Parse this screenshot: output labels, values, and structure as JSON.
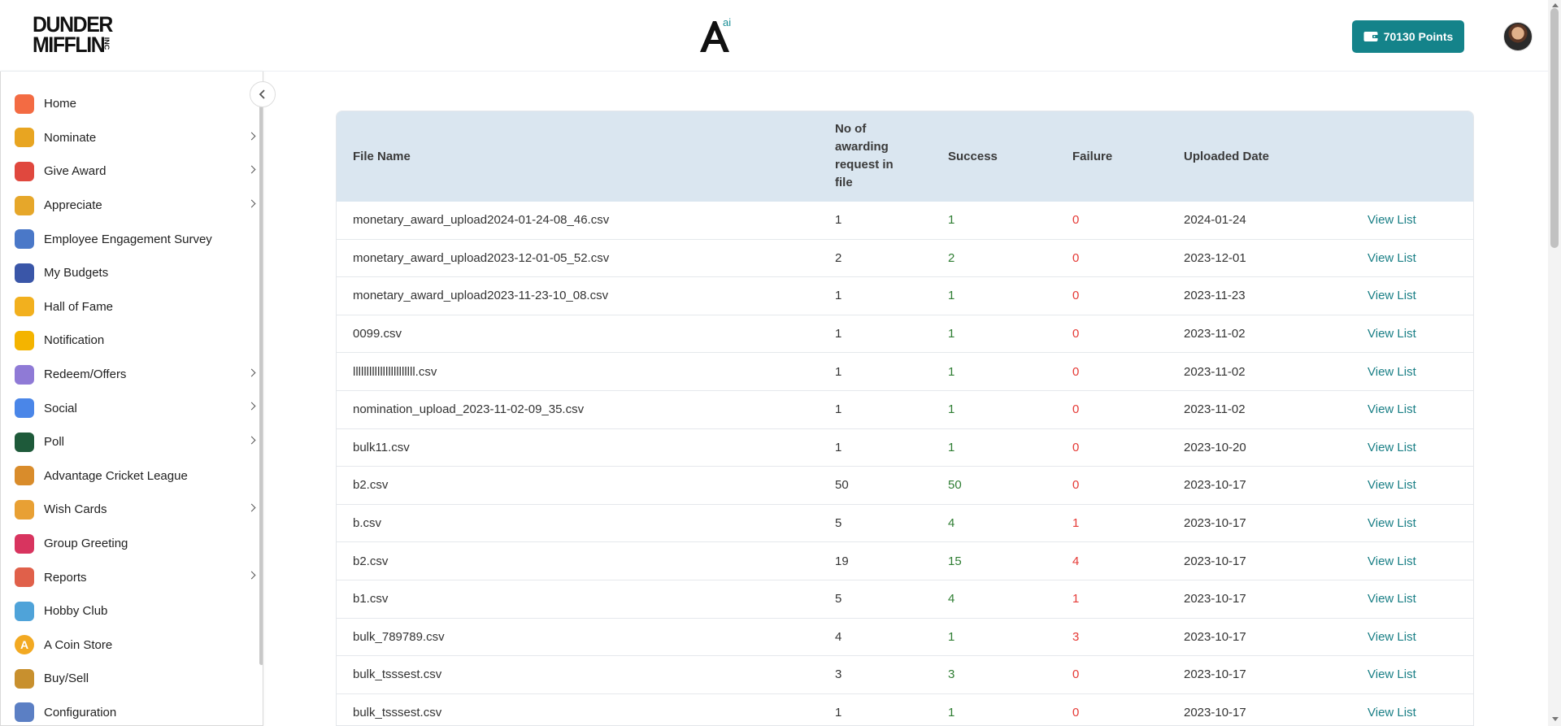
{
  "header": {
    "logo_text_line1": "DUNDER",
    "logo_text_line2": "MIFFLIN",
    "logo_suffix": "INC",
    "ai_logo_badge": "ai",
    "points_label": "70130  Points"
  },
  "sidebar": {
    "items": [
      {
        "label": "Home",
        "icon": "home-icon",
        "color": "#f36b43",
        "has_submenu": false
      },
      {
        "label": "Nominate",
        "icon": "trophy-icon",
        "color": "#e8a521",
        "has_submenu": true
      },
      {
        "label": "Give Award",
        "icon": "gift-icon",
        "color": "#e0483e",
        "has_submenu": true
      },
      {
        "label": "Appreciate",
        "icon": "medal-icon",
        "color": "#e6a72a",
        "has_submenu": true
      },
      {
        "label": "Employee Engagement Survey",
        "icon": "survey-icon",
        "color": "#4a78c8",
        "has_submenu": false
      },
      {
        "label": "My Budgets",
        "icon": "wallet-icon",
        "color": "#3a56a8",
        "has_submenu": false
      },
      {
        "label": "Hall of Fame",
        "icon": "crown-icon",
        "color": "#f2b01e",
        "has_submenu": false
      },
      {
        "label": "Notification",
        "icon": "bell-icon",
        "color": "#f4b400",
        "has_submenu": false
      },
      {
        "label": "Redeem/Offers",
        "icon": "voucher-icon",
        "color": "#8f7ad6",
        "has_submenu": true
      },
      {
        "label": "Social",
        "icon": "social-icon",
        "color": "#4a86e8",
        "has_submenu": true
      },
      {
        "label": "Poll",
        "icon": "poll-icon",
        "color": "#1e5a3a",
        "has_submenu": true
      },
      {
        "label": "Advantage Cricket League",
        "icon": "cricket-icon",
        "color": "#d98c2b",
        "has_submenu": false
      },
      {
        "label": "Wish Cards",
        "icon": "party-icon",
        "color": "#e8a034",
        "has_submenu": true
      },
      {
        "label": "Group Greeting",
        "icon": "envelope-icon",
        "color": "#d8345f",
        "has_submenu": false
      },
      {
        "label": "Reports",
        "icon": "clipboard-icon",
        "color": "#e0604a",
        "has_submenu": true
      },
      {
        "label": "Hobby Club",
        "icon": "palette-icon",
        "color": "#4fa3d9",
        "has_submenu": false
      },
      {
        "label": "A Coin Store",
        "icon": "coin-icon",
        "color": "#f2a922",
        "has_submenu": false
      },
      {
        "label": "Buy/Sell",
        "icon": "shopping-bag-icon",
        "color": "#c8902e",
        "has_submenu": false
      },
      {
        "label": "Configuration",
        "icon": "config-icon",
        "color": "#5b7fc4",
        "has_submenu": false
      }
    ]
  },
  "table": {
    "headers": {
      "file_name": "File Name",
      "requests_line1": "No of",
      "requests_line2": "awarding",
      "requests_line3": "request in",
      "requests_line4": "file",
      "success": "Success",
      "failure": "Failure",
      "uploaded_date": "Uploaded Date"
    },
    "view_label": "View List",
    "rows": [
      {
        "file": "monetary_award_upload2024-01-24-08_46.csv",
        "requests": "1",
        "success": "1",
        "failure": "0",
        "date": "2024-01-24"
      },
      {
        "file": "monetary_award_upload2023-12-01-05_52.csv",
        "requests": "2",
        "success": "2",
        "failure": "0",
        "date": "2023-12-01"
      },
      {
        "file": "monetary_award_upload2023-11-23-10_08.csv",
        "requests": "1",
        "success": "1",
        "failure": "0",
        "date": "2023-11-23"
      },
      {
        "file": "0099.csv",
        "requests": "1",
        "success": "1",
        "failure": "0",
        "date": "2023-11-02"
      },
      {
        "file": "lllllllllllllllllllllll.csv",
        "requests": "1",
        "success": "1",
        "failure": "0",
        "date": "2023-11-02"
      },
      {
        "file": "nomination_upload_2023-11-02-09_35.csv",
        "requests": "1",
        "success": "1",
        "failure": "0",
        "date": "2023-11-02"
      },
      {
        "file": "bulk11.csv",
        "requests": "1",
        "success": "1",
        "failure": "0",
        "date": "2023-10-20"
      },
      {
        "file": "b2.csv",
        "requests": "50",
        "success": "50",
        "failure": "0",
        "date": "2023-10-17"
      },
      {
        "file": "b.csv",
        "requests": "5",
        "success": "4",
        "failure": "1",
        "date": "2023-10-17"
      },
      {
        "file": "b2.csv",
        "requests": "19",
        "success": "15",
        "failure": "4",
        "date": "2023-10-17"
      },
      {
        "file": "b1.csv",
        "requests": "5",
        "success": "4",
        "failure": "1",
        "date": "2023-10-17"
      },
      {
        "file": "bulk_789789.csv",
        "requests": "4",
        "success": "1",
        "failure": "3",
        "date": "2023-10-17"
      },
      {
        "file": "bulk_tsssest.csv",
        "requests": "3",
        "success": "3",
        "failure": "0",
        "date": "2023-10-17"
      },
      {
        "file": "bulk_tsssest.csv",
        "requests": "1",
        "success": "1",
        "failure": "0",
        "date": "2023-10-17"
      }
    ]
  },
  "colors": {
    "accent": "#14838a",
    "success": "#2e7d32",
    "failure": "#e53935",
    "link": "#1a7f86",
    "table_header_bg": "#dae6f0"
  }
}
